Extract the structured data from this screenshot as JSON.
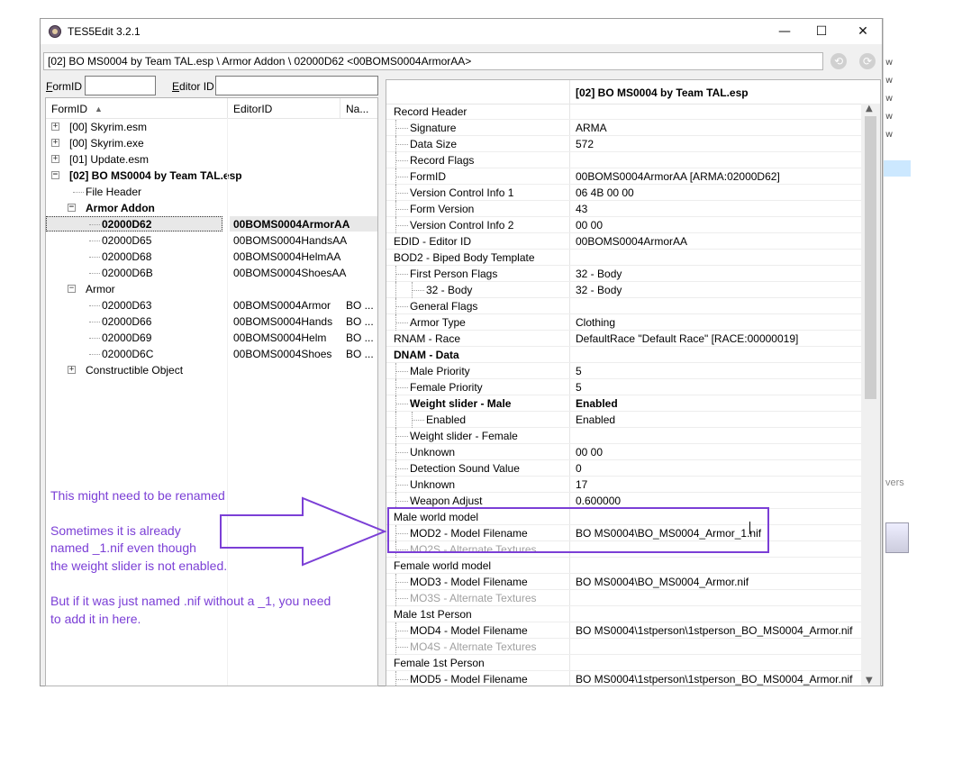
{
  "window": {
    "title": "TES5Edit 3.2.1",
    "minimize": "—",
    "maximize": "☐",
    "close": "✕"
  },
  "path": "[02] BO MS0004 by Team TAL.esp \\ Armor Addon \\ 02000D62 <00BOMS0004ArmorAA>",
  "nav": {
    "back": "⟲",
    "forward": "⟳"
  },
  "filters": {
    "formid_prefix": "F",
    "formid_rest": "ormID",
    "editorid_prefix": "E",
    "editorid_rest": "ditor ID",
    "formid_value": "",
    "editorid_value": ""
  },
  "tree": {
    "headers": {
      "formid": "FormID",
      "sort": "▲",
      "editorid": "EditorID",
      "name": "Na..."
    },
    "rows": [
      {
        "formid": "[00] Skyrim.esm",
        "editorid": "",
        "name": ""
      },
      {
        "formid": "[00] Skyrim.exe",
        "editorid": "",
        "name": ""
      },
      {
        "formid": "[01] Update.esm",
        "editorid": "",
        "name": ""
      },
      {
        "formid": "[02] BO MS0004 by Team TAL.esp",
        "editorid": "",
        "name": ""
      },
      {
        "formid": "File Header",
        "editorid": "",
        "name": ""
      },
      {
        "formid": "Armor Addon",
        "editorid": "",
        "name": ""
      },
      {
        "formid": "02000D62",
        "editorid": "00BOMS0004ArmorAA",
        "name": ""
      },
      {
        "formid": "02000D65",
        "editorid": "00BOMS0004HandsAA",
        "name": ""
      },
      {
        "formid": "02000D68",
        "editorid": "00BOMS0004HelmAA",
        "name": ""
      },
      {
        "formid": "02000D6B",
        "editorid": "00BOMS0004ShoesAA",
        "name": ""
      },
      {
        "formid": "Armor",
        "editorid": "",
        "name": ""
      },
      {
        "formid": "02000D63",
        "editorid": "00BOMS0004Armor",
        "name": "BO ..."
      },
      {
        "formid": "02000D66",
        "editorid": "00BOMS0004Hands",
        "name": "BO ..."
      },
      {
        "formid": "02000D69",
        "editorid": "00BOMS0004Helm",
        "name": "BO ..."
      },
      {
        "formid": "02000D6C",
        "editorid": "00BOMS0004Shoes",
        "name": "BO ..."
      },
      {
        "formid": "Constructible Object",
        "editorid": "",
        "name": ""
      }
    ]
  },
  "annotation": {
    "line1": "This might need to be renamed",
    "line2": "Sometimes it is already",
    "line3": "named _1.nif even though",
    "line4": "the weight slider is not enabled.",
    "line5": "But if it was just named .nif without a _1, you need",
    "line6": "to add it in here."
  },
  "record": {
    "file": "[02] BO MS0004 by Team TAL.esp",
    "rows": [
      {
        "k": "Record Header",
        "v": ""
      },
      {
        "k": "Signature",
        "v": "ARMA"
      },
      {
        "k": "Data Size",
        "v": "572"
      },
      {
        "k": "Record Flags",
        "v": ""
      },
      {
        "k": "FormID",
        "v": "00BOMS0004ArmorAA [ARMA:02000D62]"
      },
      {
        "k": "Version Control Info 1",
        "v": "06 4B 00 00"
      },
      {
        "k": "Form Version",
        "v": "43"
      },
      {
        "k": "Version Control Info 2",
        "v": "00 00"
      },
      {
        "k": "EDID - Editor ID",
        "v": "00BOMS0004ArmorAA"
      },
      {
        "k": "BOD2 - Biped Body Template",
        "v": ""
      },
      {
        "k": "First Person Flags",
        "v": "32 - Body"
      },
      {
        "k": "32 - Body",
        "v": "32 - Body"
      },
      {
        "k": "General Flags",
        "v": ""
      },
      {
        "k": "Armor Type",
        "v": "Clothing"
      },
      {
        "k": "RNAM - Race",
        "v": "DefaultRace \"Default Race\" [RACE:00000019]"
      },
      {
        "k": "DNAM - Data",
        "v": ""
      },
      {
        "k": "Male Priority",
        "v": "5"
      },
      {
        "k": "Female Priority",
        "v": "5"
      },
      {
        "k": "Weight slider - Male",
        "v": "Enabled"
      },
      {
        "k": "Enabled",
        "v": "Enabled"
      },
      {
        "k": "Weight slider - Female",
        "v": ""
      },
      {
        "k": "Unknown",
        "v": "00 00"
      },
      {
        "k": "Detection Sound Value",
        "v": "0"
      },
      {
        "k": "Unknown",
        "v": "17"
      },
      {
        "k": "Weapon Adjust",
        "v": "0.600000"
      },
      {
        "k": "Male world model",
        "v": ""
      },
      {
        "k": "MOD2 - Model Filename",
        "v": "BO MS0004\\BO_MS0004_Armor_1.nif"
      },
      {
        "k": "MO2S - Alternate Textures",
        "v": ""
      },
      {
        "k": "Female world model",
        "v": ""
      },
      {
        "k": "MOD3 - Model Filename",
        "v": "BO MS0004\\BO_MS0004_Armor.nif"
      },
      {
        "k": "MO3S - Alternate Textures",
        "v": ""
      },
      {
        "k": "Male 1st Person",
        "v": ""
      },
      {
        "k": "MOD4 - Model Filename",
        "v": "BO MS0004\\1stperson\\1stperson_BO_MS0004_Armor.nif"
      },
      {
        "k": "MO4S - Alternate Textures",
        "v": ""
      },
      {
        "k": "Female 1st Person",
        "v": ""
      },
      {
        "k": "MOD5 - Model Filename",
        "v": "BO MS0004\\1stperson\\1stperson_BO_MS0004_Armor.nif"
      }
    ]
  },
  "background_window": {
    "chars": [
      "w",
      "w",
      "w",
      "w",
      "w"
    ],
    "label": "vers"
  },
  "colors": {
    "annotation": "#7b3fd6",
    "selection": "#cce8ff"
  }
}
